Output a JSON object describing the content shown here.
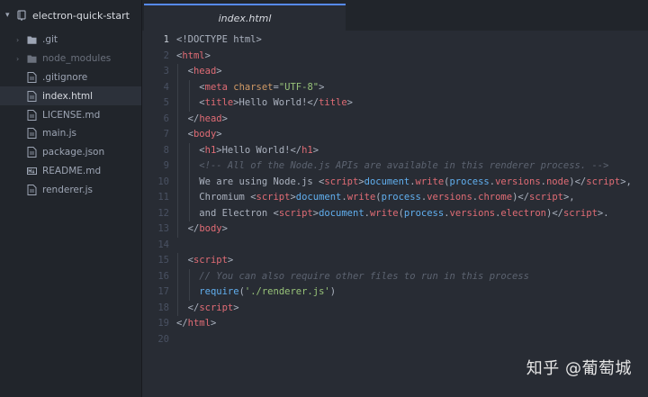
{
  "project": {
    "name": "electron-quick-start"
  },
  "tree": [
    {
      "label": ".git",
      "kind": "folder",
      "dim": false
    },
    {
      "label": "node_modules",
      "kind": "folder",
      "dim": true
    },
    {
      "label": ".gitignore",
      "kind": "file"
    },
    {
      "label": "index.html",
      "kind": "file",
      "selected": true
    },
    {
      "label": "LICENSE.md",
      "kind": "file"
    },
    {
      "label": "main.js",
      "kind": "file"
    },
    {
      "label": "package.json",
      "kind": "file"
    },
    {
      "label": "README.md",
      "kind": "markdown"
    },
    {
      "label": "renderer.js",
      "kind": "file"
    }
  ],
  "tab": {
    "label": "index.html"
  },
  "active_line": 1,
  "code_lines": [
    {
      "n": "1",
      "indent": 0,
      "tokens": [
        [
          "p",
          "<!DOCTYPE html>"
        ]
      ]
    },
    {
      "n": "2",
      "indent": 0,
      "tokens": [
        [
          "p",
          "<"
        ],
        [
          "t",
          "html"
        ],
        [
          "p",
          ">"
        ]
      ]
    },
    {
      "n": "3",
      "indent": 1,
      "tokens": [
        [
          "p",
          "<"
        ],
        [
          "t",
          "head"
        ],
        [
          "p",
          ">"
        ]
      ]
    },
    {
      "n": "4",
      "indent": 2,
      "tokens": [
        [
          "p",
          "<"
        ],
        [
          "t",
          "meta"
        ],
        [
          "p",
          " "
        ],
        [
          "a",
          "charset"
        ],
        [
          "p",
          "="
        ],
        [
          "s",
          "\"UTF-8\""
        ],
        [
          "p",
          ">"
        ]
      ]
    },
    {
      "n": "5",
      "indent": 2,
      "tokens": [
        [
          "p",
          "<"
        ],
        [
          "t",
          "title"
        ],
        [
          "p",
          ">Hello World!</"
        ],
        [
          "t",
          "title"
        ],
        [
          "p",
          ">"
        ]
      ]
    },
    {
      "n": "6",
      "indent": 1,
      "tokens": [
        [
          "p",
          "</"
        ],
        [
          "t",
          "head"
        ],
        [
          "p",
          ">"
        ]
      ]
    },
    {
      "n": "7",
      "indent": 1,
      "tokens": [
        [
          "p",
          "<"
        ],
        [
          "t",
          "body"
        ],
        [
          "p",
          ">"
        ]
      ]
    },
    {
      "n": "8",
      "indent": 2,
      "tokens": [
        [
          "p",
          "<"
        ],
        [
          "t",
          "h1"
        ],
        [
          "p",
          ">Hello World!</"
        ],
        [
          "t",
          "h1"
        ],
        [
          "p",
          ">"
        ]
      ]
    },
    {
      "n": "9",
      "indent": 2,
      "tokens": [
        [
          "c",
          "<!-- All of the Node.js APIs are available in this renderer process. -->"
        ]
      ]
    },
    {
      "n": "10",
      "indent": 2,
      "tokens": [
        [
          "p",
          "We are using Node.js <"
        ],
        [
          "t",
          "script"
        ],
        [
          "p",
          ">"
        ],
        [
          "f",
          "document"
        ],
        [
          "p",
          "."
        ],
        [
          "t",
          "write"
        ],
        [
          "p",
          "("
        ],
        [
          "f",
          "process"
        ],
        [
          "p",
          "."
        ],
        [
          "t",
          "versions"
        ],
        [
          "p",
          "."
        ],
        [
          "t",
          "node"
        ],
        [
          "p",
          ")</"
        ],
        [
          "t",
          "script"
        ],
        [
          "p",
          ">,"
        ]
      ]
    },
    {
      "n": "11",
      "indent": 2,
      "tokens": [
        [
          "p",
          "Chromium <"
        ],
        [
          "t",
          "script"
        ],
        [
          "p",
          ">"
        ],
        [
          "f",
          "document"
        ],
        [
          "p",
          "."
        ],
        [
          "t",
          "write"
        ],
        [
          "p",
          "("
        ],
        [
          "f",
          "process"
        ],
        [
          "p",
          "."
        ],
        [
          "t",
          "versions"
        ],
        [
          "p",
          "."
        ],
        [
          "t",
          "chrome"
        ],
        [
          "p",
          ")</"
        ],
        [
          "t",
          "script"
        ],
        [
          "p",
          ">,"
        ]
      ]
    },
    {
      "n": "12",
      "indent": 2,
      "tokens": [
        [
          "p",
          "and Electron <"
        ],
        [
          "t",
          "script"
        ],
        [
          "p",
          ">"
        ],
        [
          "f",
          "document"
        ],
        [
          "p",
          "."
        ],
        [
          "t",
          "write"
        ],
        [
          "p",
          "("
        ],
        [
          "f",
          "process"
        ],
        [
          "p",
          "."
        ],
        [
          "t",
          "versions"
        ],
        [
          "p",
          "."
        ],
        [
          "t",
          "electron"
        ],
        [
          "p",
          ")</"
        ],
        [
          "t",
          "script"
        ],
        [
          "p",
          ">."
        ]
      ]
    },
    {
      "n": "13",
      "indent": 1,
      "tokens": [
        [
          "p",
          "</"
        ],
        [
          "t",
          "body"
        ],
        [
          "p",
          ">"
        ]
      ]
    },
    {
      "n": "14",
      "indent": 0,
      "tokens": []
    },
    {
      "n": "15",
      "indent": 1,
      "tokens": [
        [
          "p",
          "<"
        ],
        [
          "t",
          "script"
        ],
        [
          "p",
          ">"
        ]
      ]
    },
    {
      "n": "16",
      "indent": 2,
      "tokens": [
        [
          "c",
          "// You can also require other files to run in this process"
        ]
      ]
    },
    {
      "n": "17",
      "indent": 2,
      "tokens": [
        [
          "f",
          "require"
        ],
        [
          "p",
          "("
        ],
        [
          "s",
          "'./renderer.js'"
        ],
        [
          "p",
          ")"
        ]
      ]
    },
    {
      "n": "18",
      "indent": 1,
      "tokens": [
        [
          "p",
          "</"
        ],
        [
          "t",
          "script"
        ],
        [
          "p",
          ">"
        ]
      ]
    },
    {
      "n": "19",
      "indent": 0,
      "tokens": [
        [
          "p",
          "</"
        ],
        [
          "t",
          "html"
        ],
        [
          "p",
          ">"
        ]
      ]
    },
    {
      "n": "20",
      "indent": 0,
      "tokens": []
    }
  ],
  "watermark": {
    "text": "知乎 @葡萄城"
  },
  "colors": {
    "tag": "#e06c75",
    "attr": "#d19a66",
    "string": "#98c379",
    "comment": "#5c6370",
    "func": "#61afef",
    "accent": "#568af2"
  }
}
